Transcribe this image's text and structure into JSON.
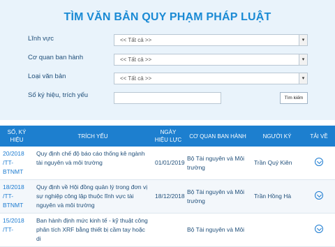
{
  "title": "TÌM VĂN BẢN QUY PHẠM PHÁP LUẬT",
  "form": {
    "field_label": "Lĩnh vực",
    "field_value": "<< Tất cả >>",
    "agency_label": "Cơ quan ban hành",
    "agency_value": "<< Tất cả >>",
    "type_label": "Loại văn bản",
    "type_value": "<< Tất cả >>",
    "keyword_label": "Số ký hiệu, trích yếu",
    "keyword_value": "",
    "search_button": "Tìm kiếm"
  },
  "table": {
    "headers": [
      "SỐ, KÝ HIỆU",
      "TRÍCH YẾU",
      "NGÀY HIỆU LỰC",
      "CƠ QUAN BAN HÀNH",
      "NGƯỜI KÝ",
      "TẢI VỀ"
    ],
    "rows": [
      {
        "code": "20/2018 /TT-BTNMT",
        "summary": "Quy định chế độ báo cáo thống kê ngành tài nguyên và môi trường",
        "date": "01/01/2019",
        "agency": "Bộ Tài nguyên và Môi trường",
        "signer": "Trần Quý Kiên"
      },
      {
        "code": "18/2018 /TT-BTNMT",
        "summary": "Quy định về Hội đồng quản lý trong đơn vị sự nghiệp công lập thuộc lĩnh vực tài nguyên và môi trường",
        "date": "18/12/2018",
        "agency": "Bộ Tài nguyên và Môi trường",
        "signer": "Trần Hồng Hà"
      },
      {
        "code": "15/2018 /TT-",
        "summary": "Ban hành định mức kinh tế - kỹ thuật công phân tích XRF bằng thiết bị cầm tay hoặc di",
        "date": "",
        "agency": "Bộ Tài nguyên và Môi",
        "signer": ""
      }
    ]
  },
  "icons": {
    "download": "download-circle-icon",
    "dropdown": "chevron-down-icon"
  }
}
